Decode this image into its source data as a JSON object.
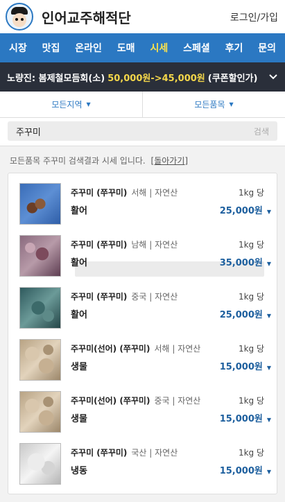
{
  "header": {
    "logo_text": "인어교주해적단",
    "auth_links": "로그인/가입"
  },
  "nav": {
    "items": [
      {
        "label": "시장",
        "active": false
      },
      {
        "label": "맛집",
        "active": false
      },
      {
        "label": "온라인",
        "active": false
      },
      {
        "label": "도매",
        "active": false
      },
      {
        "label": "시세",
        "active": true
      },
      {
        "label": "스페셜",
        "active": false
      },
      {
        "label": "후기",
        "active": false
      },
      {
        "label": "문의",
        "active": false
      }
    ]
  },
  "banner": {
    "lead": "노량진: 봄제철모듬회(소)",
    "price_change": "50,000원->45,000원",
    "tail": "(쿠폰할인가)",
    "chevron_icon": "chevron-down-icon"
  },
  "filters": {
    "region": "모든지역",
    "product": "모든품목"
  },
  "search": {
    "value": "주꾸미",
    "button": "검색"
  },
  "result_info": {
    "text": "모든품목 주꾸미 검색결과 시세 입니다.",
    "back_link": "[돌아가기]"
  },
  "items": [
    {
      "name": "주꾸미 (쭈꾸미)",
      "origin": "서해 | 자연산",
      "state": "활어",
      "unit": "1kg 당",
      "price": "25,000원"
    },
    {
      "name": "주꾸미 (쭈꾸미)",
      "origin": "남해 | 자연산",
      "state": "활어",
      "unit": "1kg 당",
      "price": "35,000원"
    },
    {
      "name": "주꾸미 (쭈꾸미)",
      "origin": "중국 | 자연산",
      "state": "활어",
      "unit": "1kg 당",
      "price": "25,000원"
    },
    {
      "name": "주꾸미(선어) (쭈꾸미)",
      "origin": "서해 | 자연산",
      "state": "생물",
      "unit": "1kg 당",
      "price": "15,000원"
    },
    {
      "name": "주꾸미(선어) (쭈꾸미)",
      "origin": "중국 | 자연산",
      "state": "생물",
      "unit": "1kg 당",
      "price": "15,000원"
    },
    {
      "name": "주꾸미 (쭈꾸미)",
      "origin": "국산 | 자연산",
      "state": "냉동",
      "unit": "1kg 당",
      "price": "15,000원"
    }
  ],
  "colors": {
    "brand_blue": "#2b78c2",
    "nav_active": "#ffe44a",
    "banner_bg": "#2a2f3a",
    "banner_price": "#f3d64a",
    "price_text": "#1d5f9e"
  }
}
